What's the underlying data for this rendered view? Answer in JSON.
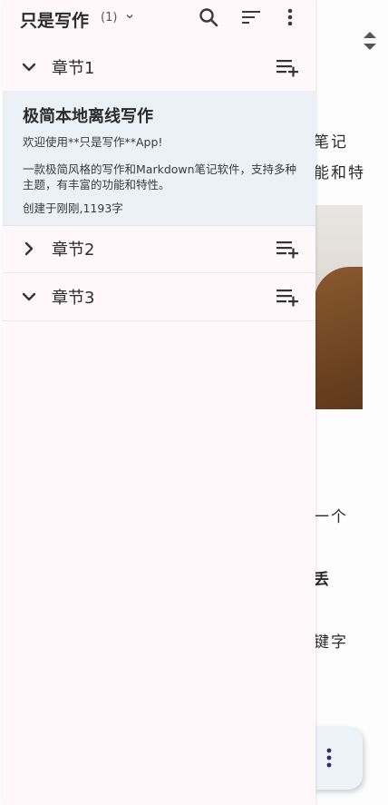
{
  "header": {
    "title": "只是写作",
    "count": "(1)"
  },
  "chapters": [
    {
      "label": "章节1",
      "expanded": true
    },
    {
      "label": "章节2",
      "expanded": false
    },
    {
      "label": "章节3",
      "expanded": true
    }
  ],
  "note": {
    "title": "极简本地离线写作",
    "welcome": "欢迎使用**只是写作**App!",
    "description": "一款极简风格的写作和Markdown笔记软件，支持多种主题，有丰富的功能和特性。",
    "meta": "创建于刚刚,1193字"
  },
  "background_editor": {
    "line1": "笔记",
    "line2": "能和特",
    "line3": "一个",
    "line4": "丢",
    "line5": "键字"
  },
  "colors": {
    "drawer_bg": "#fef8fb",
    "selected_note_bg": "#ebf1f5",
    "fab_bg": "#eef3f8",
    "accent_dots": "#2b2a7a"
  },
  "icons": [
    "chevron-down-icon",
    "search-icon",
    "sort-icon",
    "more-vert-icon",
    "playlist-add-icon",
    "chevron-right-icon",
    "unfold-icon"
  ]
}
